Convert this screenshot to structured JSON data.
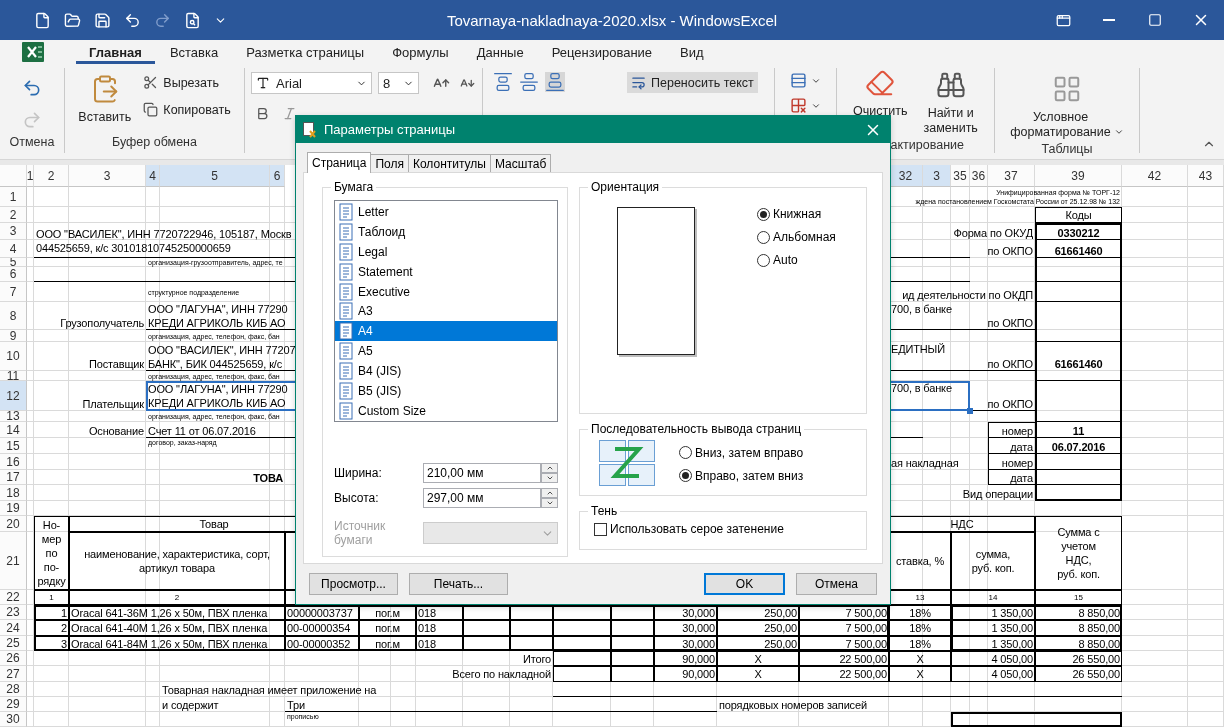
{
  "window": {
    "title": "Tovarnaya-nakladnaya-2020.xlsx - WindowsExcel"
  },
  "ribbon_tabs": [
    {
      "label": "Главная",
      "selected": true
    },
    {
      "label": "Вставка",
      "selected": false
    },
    {
      "label": "Разметка страницы",
      "selected": false
    },
    {
      "label": "Формулы",
      "selected": false
    },
    {
      "label": "Данные",
      "selected": false
    },
    {
      "label": "Рецензирование",
      "selected": false
    },
    {
      "label": "Вид",
      "selected": false
    }
  ],
  "ribbon": {
    "undo": {
      "label": "Отмена"
    },
    "clipboard": {
      "paste": "Вставить",
      "cut": "Вырезать",
      "copy": "Копировать",
      "label": "Буфер обмена"
    },
    "font": {
      "name": "Arial",
      "size": "8"
    },
    "alignment": {
      "wrap_text": "Переносить текст"
    },
    "editing": {
      "clear": "Очистить",
      "find": "Найти и\nзаменить",
      "label": "актирование"
    },
    "styles": {
      "conditional": "Условное\nформатирование",
      "label": "Таблицы"
    }
  },
  "sheet": {
    "columns": [
      {
        "label": "1",
        "selected": false
      },
      {
        "label": "2",
        "selected": false
      },
      {
        "label": "3",
        "selected": false
      },
      {
        "label": "4",
        "selected": true
      },
      {
        "label": "5",
        "selected": true
      },
      {
        "label": "6",
        "selected": true
      },
      {
        "label": "32",
        "selected": true
      },
      {
        "label": "3",
        "selected": true
      },
      {
        "label": "35",
        "selected": false
      },
      {
        "label": "36",
        "selected": false
      },
      {
        "label": "37",
        "selected": false
      },
      {
        "label": "39",
        "selected": false
      },
      {
        "label": "42",
        "selected": false
      },
      {
        "label": "43",
        "selected": false
      }
    ],
    "rows": [
      {
        "number": "1",
        "selected": false,
        "cells": [
          {
            "text": "Унифицированная форма № ТОРГ-12\nждена постановлением Госкомстата России от 25.12.98 № 132"
          }
        ]
      },
      {
        "number": "2",
        "selected": false,
        "cells": [
          {
            "text": "Коды"
          }
        ]
      },
      {
        "number": "3",
        "selected": false,
        "cells": [
          {
            "text": "ООО \"ВАСИЛЕК\", ИНН 7720722946, 105187, Москв\n044525659, к/с 30101810745250000659"
          },
          {
            "text": "Форма по ОКУД"
          },
          {
            "text": "0330212"
          }
        ]
      },
      {
        "number": "4",
        "selected": false,
        "cells": [
          {
            "text": "по ОКПО"
          },
          {
            "text": "61661460"
          }
        ]
      },
      {
        "number": "5",
        "selected": false,
        "cells": [
          {
            "text": "организация-грузоотправитель, адрес, те"
          }
        ]
      },
      {
        "number": "6",
        "selected": false
      },
      {
        "number": "7",
        "selected": false,
        "cells": [
          {
            "text": "структурное подразделение"
          },
          {
            "text": "ид деятельности по ОКДП"
          }
        ]
      },
      {
        "number": "8",
        "selected": false,
        "cells": [
          {
            "text": "Грузополучатель"
          },
          {
            "text": "ООО \"ЛАГУНА\", ИНН 77290\nКРЕДИ АГРИКОЛЬ КИБ АО"
          },
          {
            "text": "700, в банке"
          },
          {
            "text": "по ОКПО"
          }
        ]
      },
      {
        "number": "9",
        "selected": false,
        "cells": [
          {
            "text": "организация, адрес, телефон, факс, бан"
          }
        ]
      },
      {
        "number": "10",
        "selected": false,
        "cells": [
          {
            "text": "Поставщик"
          },
          {
            "text": "ООО \"ВАСИЛЕК\", ИНН 77207\nБАНК\", БИК 044525659, к/с"
          },
          {
            "text": "ЕДИТНЫЙ"
          },
          {
            "text": "по ОКПО"
          },
          {
            "text": "61661460"
          }
        ]
      },
      {
        "number": "11",
        "selected": false,
        "cells": [
          {
            "text": "организация, адрес, телефон, факс, бан"
          }
        ]
      },
      {
        "number": "12",
        "selected": true,
        "cells": [
          {
            "text": "Плательщик"
          },
          {
            "text": "ООО \"ЛАГУНА\", ИНН 77290\nКРЕДИ АГРИКОЛЬ КИБ АО"
          },
          {
            "text": "700, в банке"
          },
          {
            "text": "по ОКПО"
          }
        ]
      },
      {
        "number": "13",
        "selected": false,
        "cells": [
          {
            "text": "организация, адрес, телефон, факс, бан"
          }
        ]
      },
      {
        "number": "14",
        "selected": false,
        "cells": [
          {
            "text": "Основание"
          },
          {
            "text": "Счет 11 от 06.07.2016"
          },
          {
            "text": "номер"
          },
          {
            "text": "11"
          }
        ]
      },
      {
        "number": "15",
        "selected": false,
        "cells": [
          {
            "text": "договор, заказ-наряд"
          },
          {
            "text": "дата"
          },
          {
            "text": "06.07.2016"
          }
        ]
      },
      {
        "number": "16",
        "selected": false,
        "cells": [
          {
            "text": "ая накладная"
          },
          {
            "text": "номер"
          }
        ]
      },
      {
        "number": "17",
        "selected": false,
        "cells": [
          {
            "text": "ТОВА"
          },
          {
            "text": "дата"
          }
        ]
      },
      {
        "number": "18",
        "selected": false,
        "cells": [
          {
            "text": "Вид операции"
          }
        ]
      },
      {
        "number": "19",
        "selected": false
      },
      {
        "number": "20",
        "selected": false,
        "cells": [
          {
            "text": "Но-\nмер\nпо\nпо-\nрядку"
          },
          {
            "text": "Товар"
          },
          {
            "text": "НДС"
          },
          {
            "text": "Сумма с\nучетом\nНДС,\nруб. коп."
          }
        ]
      },
      {
        "number": "21",
        "selected": false,
        "cells": [
          {
            "text": "наименование, характеристика, сорт,\nартикул товара"
          },
          {
            "text": "ставка, %"
          },
          {
            "text": "сумма,\nруб. коп."
          }
        ]
      },
      {
        "number": "22",
        "selected": false,
        "cells": [
          {
            "text": "1"
          },
          {
            "text": "2"
          },
          {
            "text": "13"
          },
          {
            "text": "14"
          },
          {
            "text": "15"
          }
        ]
      },
      {
        "number": "23",
        "selected": false,
        "cells": [
          {
            "text": "1"
          },
          {
            "text": "Oracal 641-36M 1,26 x 50м, ПВХ пленка"
          },
          {
            "text": "00000003737"
          },
          {
            "text": "пог.м"
          },
          {
            "text": "018"
          },
          {
            "text": "30,000"
          },
          {
            "text": "250,00"
          },
          {
            "text": "7 500,00"
          },
          {
            "text": "18%"
          },
          {
            "text": "1 350,00"
          },
          {
            "text": "8 850,00"
          }
        ]
      },
      {
        "number": "24",
        "selected": false,
        "cells": [
          {
            "text": "2"
          },
          {
            "text": "Oracal 641-40M 1,26 x 50м, ПВХ пленка"
          },
          {
            "text": "00-00000354"
          },
          {
            "text": "пог.м"
          },
          {
            "text": "018"
          },
          {
            "text": "30,000"
          },
          {
            "text": "250,00"
          },
          {
            "text": "7 500,00"
          },
          {
            "text": "18%"
          },
          {
            "text": "1 350,00"
          },
          {
            "text": "8 850,00"
          }
        ]
      },
      {
        "number": "25",
        "selected": false,
        "cells": [
          {
            "text": "3"
          },
          {
            "text": "Oracal 641-84M 1,26 x 50м, ПВХ пленка"
          },
          {
            "text": "00-00000352"
          },
          {
            "text": "пог.м"
          },
          {
            "text": "018"
          },
          {
            "text": "30,000"
          },
          {
            "text": "250,00"
          },
          {
            "text": "7 500,00"
          },
          {
            "text": "18%"
          },
          {
            "text": "1 350,00"
          },
          {
            "text": "8 850,00"
          }
        ]
      },
      {
        "number": "26",
        "selected": false,
        "cells": [
          {
            "text": "Итого"
          },
          {
            "text": "90,000"
          },
          {
            "text": "X"
          },
          {
            "text": "22 500,00"
          },
          {
            "text": "X"
          },
          {
            "text": "4 050,00"
          },
          {
            "text": "26 550,00"
          }
        ]
      },
      {
        "number": "27",
        "selected": false,
        "cells": [
          {
            "text": "Всего по накладной"
          },
          {
            "text": "90,000"
          },
          {
            "text": "X"
          },
          {
            "text": "22 500,00"
          },
          {
            "text": "X"
          },
          {
            "text": "4 050,00"
          },
          {
            "text": "26 550,00"
          }
        ]
      },
      {
        "number": "28",
        "selected": false,
        "cells": [
          {
            "text": "Товарная накладная имеет приложение на"
          }
        ]
      },
      {
        "number": "29",
        "selected": false,
        "cells": [
          {
            "text": "и содержит"
          },
          {
            "text": "Три"
          },
          {
            "text": "порядковых номеров записей"
          }
        ]
      },
      {
        "number": "30",
        "selected": false,
        "cells": [
          {
            "text": "прописью"
          }
        ]
      }
    ]
  },
  "dialog": {
    "title": "Параметры страницы",
    "tabs": [
      {
        "label": "Страница",
        "selected": true
      },
      {
        "label": "Поля",
        "selected": false
      },
      {
        "label": "Колонтитулы",
        "selected": false
      },
      {
        "label": "Масштаб",
        "selected": false
      }
    ],
    "paper": {
      "label": "Бумага",
      "sizes": [
        {
          "label": "Letter",
          "selected": false
        },
        {
          "label": "Таблоид",
          "selected": false
        },
        {
          "label": "Legal",
          "selected": false
        },
        {
          "label": "Statement",
          "selected": false
        },
        {
          "label": "Executive",
          "selected": false
        },
        {
          "label": "A3",
          "selected": false
        },
        {
          "label": "A4",
          "selected": true
        },
        {
          "label": "A5",
          "selected": false
        },
        {
          "label": "B4 (JIS)",
          "selected": false
        },
        {
          "label": "B5 (JIS)",
          "selected": false
        },
        {
          "label": "Custom Size",
          "selected": false
        }
      ],
      "width_label": "Ширина:",
      "width": "210,00 мм",
      "height_label": "Высота:",
      "height": "297,00 мм",
      "source": {
        "label": "Источник бумаги",
        "disabled": true
      }
    },
    "orientation": {
      "label": "Ориентация",
      "options": [
        {
          "label": "Книжная",
          "selected": true
        },
        {
          "label": "Альбомная",
          "selected": false
        },
        {
          "label": "Auto",
          "selected": false
        }
      ]
    },
    "page_order": {
      "label": "Последовательность вывода страниц",
      "options": [
        {
          "label": "Вниз, затем вправо",
          "selected": false
        },
        {
          "label": "Вправо, затем вниз",
          "selected": true
        }
      ]
    },
    "shading": {
      "label": "Тень",
      "option": "Использовать серое затенение",
      "checked": false
    },
    "buttons": [
      {
        "label": "Просмотр...",
        "default": false
      },
      {
        "label": "Печать...",
        "default": false
      },
      {
        "label": "OK",
        "default": true
      },
      {
        "label": "Отмена",
        "default": false
      }
    ]
  }
}
